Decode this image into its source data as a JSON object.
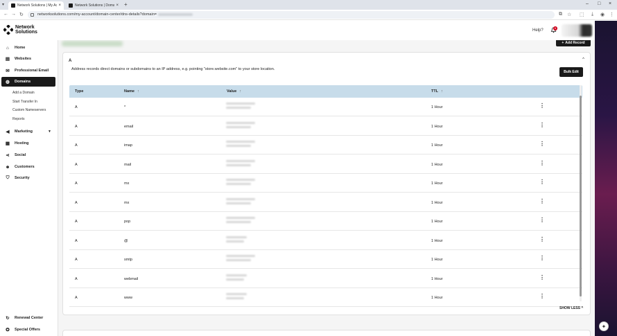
{
  "browser": {
    "tabs": [
      {
        "title": "Network Solutions | My Acco",
        "active": true
      },
      {
        "title": "Network Solutions | Domain",
        "active": false
      }
    ],
    "url_text": "networksolutions.com/my-account/domain-center/dns-details?domain="
  },
  "header": {
    "logo_line1": "Network",
    "logo_line2": "Solutions",
    "help_label": "Help?",
    "notification_count": "6"
  },
  "sidebar": {
    "items": [
      {
        "label": "Home",
        "icon": "home-icon"
      },
      {
        "label": "Websites",
        "icon": "websites-icon"
      },
      {
        "label": "Professional Email",
        "icon": "email-icon"
      },
      {
        "label": "Domains",
        "icon": "globe-icon",
        "active": true
      },
      {
        "label": "Marketing",
        "icon": "megaphone-icon"
      },
      {
        "label": "Hosting",
        "icon": "hosting-icon"
      },
      {
        "label": "Social",
        "icon": "share-icon"
      },
      {
        "label": "Customers",
        "icon": "users-icon"
      },
      {
        "label": "Security",
        "icon": "shield-icon"
      }
    ],
    "domain_subitems": [
      "Add a Domain",
      "Start Transfer In",
      "Custom Nameservers",
      "Reports"
    ],
    "bottom_items": [
      {
        "label": "Renewal Center",
        "icon": "renew-icon"
      },
      {
        "label": "Special Offers",
        "icon": "offers-icon"
      }
    ]
  },
  "main": {
    "add_record_label": "Add Record",
    "card": {
      "title": "A",
      "description": "Address records direct domains or subdomains to an IP address, e.g. pointing \"store.website.com\" to your store location.",
      "bulk_edit_label": "Bulk Edit",
      "columns": [
        "Type",
        "Name",
        "Value",
        "TTL"
      ],
      "rows": [
        {
          "type": "A",
          "name": "*",
          "ttl": "1 Hour"
        },
        {
          "type": "A",
          "name": "email",
          "ttl": "1 Hour"
        },
        {
          "type": "A",
          "name": "imap",
          "ttl": "1 Hour"
        },
        {
          "type": "A",
          "name": "mail",
          "ttl": "1 Hour"
        },
        {
          "type": "A",
          "name": "mx",
          "ttl": "1 Hour"
        },
        {
          "type": "A",
          "name": "mx",
          "ttl": "1 Hour"
        },
        {
          "type": "A",
          "name": "pop",
          "ttl": "1 Hour"
        },
        {
          "type": "A",
          "name": "@",
          "ttl": "1 Hour"
        },
        {
          "type": "A",
          "name": "smtp",
          "ttl": "1 Hour"
        },
        {
          "type": "A",
          "name": "webmail",
          "ttl": "1 Hour"
        },
        {
          "type": "A",
          "name": "www",
          "ttl": "1 Hour"
        }
      ],
      "show_less_label": "SHOW LESS"
    }
  },
  "colors": {
    "accent_dark": "#1a1a1a",
    "table_header": "#c7dcea",
    "badge_red": "#d0021b"
  }
}
